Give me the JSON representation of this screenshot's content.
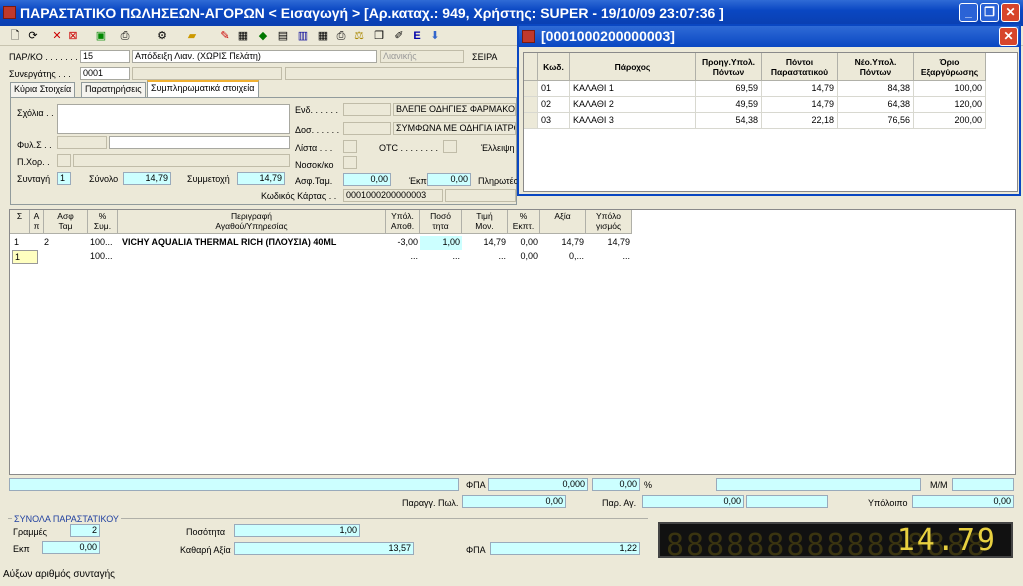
{
  "window": {
    "title": "ΠΑΡΑΣΤΑΤΙΚΟ ΠΩΛΗΣΕΩΝ-ΑΓΟΡΩΝ < Εισαγωγή > [Αρ.καταχ.: 949, Χρήστης: SUPER - 19/10/09 23:07:36 ]"
  },
  "header": {
    "parko_label": "ΠΑΡ/ΚΟ . . . . . . . .",
    "parko_code": "15",
    "parko_desc": "Απόδειξη Λιαν. (ΧΩΡΙΣ Πελάτη)",
    "retail": "Λιανικής",
    "seira_label": "ΣΕΙΡΑ",
    "synergatis_label": "Συνεργάτης . . .",
    "synergatis_code": "0001"
  },
  "tabs": [
    "Κύρια Στοιχεία",
    "Παρατηρήσεις",
    "Συμπληρωματικά στοιχεία"
  ],
  "panel": {
    "sxolia": "Σχόλια . .",
    "fyl": "Φυλ.Σ . .",
    "pxor": "Π.Χορ. .",
    "syntagi": "Συνταγή",
    "syntagi_val": "1",
    "synolo": "Σύνολο",
    "synolo_val": "14,79",
    "symmetoxi": "Συμμετοχή",
    "symmetoxi_val": "14,79",
    "end": "Ενδ. . . . . .",
    "end_val": "ΒΛΕΠΕ ΟΔΗΓΙΕΣ ΦΑΡΜΑΚΟΥ...",
    "dos": "Δοσ. . . . . .",
    "dos_val": "ΣΥΜΦΩΝΑ ΜΕ ΟΔΗΓΙΑ ΙΑΤΡΟΥ",
    "lista": "Λίστα . . .",
    "otc": "OTC . . . . . . . .",
    "elleipsi": "Έλλειψη",
    "nosok": "Νοσοκ/κο",
    "asftam": "Ασφ.Ταμ.",
    "asftam_val": "0,00",
    "ekpt": "Έκπτ.",
    "ekpt_val": "0,00",
    "plirotea": "Πληρωτέο",
    "kodikos": "Κωδικός Κάρτας . .",
    "kodikos_val": "0001000200000003"
  },
  "grid": {
    "headers": [
      "Σ",
      "Α\nπ",
      "Ασφ\nΤαμ",
      "%\nΣυμ.",
      "Περιγραφή\nΑγαθού/Υπηρεσίας",
      "Υπόλ.\nΑποθ.",
      "Ποσό\nτητα",
      "Τιμή\nΜον.",
      "%\nΕκπτ.",
      "Αξία",
      "Υπόλο\nγισμός"
    ],
    "rows": [
      [
        "1",
        "2",
        "",
        "100...",
        "VICHY AQUALIA THERMAL RICH (ΠΛΟΥΣΙΑ) 40ML",
        "-3,00",
        "1,00",
        "14,79",
        "0,00",
        "14,79",
        "14,79"
      ],
      [
        "1",
        "",
        "",
        "100...",
        "",
        "...",
        "...",
        "...",
        "0,00",
        "0,...",
        "..."
      ]
    ]
  },
  "popup": {
    "title": "[0001000200000003]",
    "headers": [
      "Κωδ.",
      "Πάροχος",
      "Προηγ.Υπολ.\nΠόντων",
      "Πόντοι\nΠαραστατικού",
      "Νέο.Υπολ.\nΠόντων",
      "Όριο\nΕξαργύρωσης"
    ],
    "rows": [
      [
        "01",
        "ΚΑΛΑΘΙ 1",
        "69,59",
        "14,79",
        "84,38",
        "100,00"
      ],
      [
        "02",
        "ΚΑΛΑΘΙ 2",
        "49,59",
        "14,79",
        "64,38",
        "120,00"
      ],
      [
        "03",
        "ΚΑΛΑΘΙ 3",
        "54,38",
        "22,18",
        "76,56",
        "200,00"
      ]
    ]
  },
  "footer": {
    "fpa": "ΦΠΑ",
    "fpa1": "0,000",
    "fpa2": "0,00",
    "pct": "%",
    "mm": "Μ/Μ",
    "paragg": "Παραγγ. Πωλ.",
    "paragg_val": "0,00",
    "par_ag": "Παρ. Αγ.",
    "par_ag_val": "0,00",
    "ypoloipo": "Υπόλοιπο",
    "ypoloipo_val": "0,00"
  },
  "totals": {
    "group": "ΣΥΝΟΛΑ ΠΑΡΑΣΤΑΤΙΚΟΥ",
    "grammes": "Γραμμές",
    "grammes_val": "2",
    "ekp": "Εκπ",
    "ekp_val": "0,00",
    "posotita": "Ποσότητα",
    "posotita_val": "1,00",
    "kathari": "Καθαρή Αξία",
    "kathari_val": "13,57",
    "fpa": "ΦΠΑ",
    "fpa_val": "1,22",
    "display": "14.79",
    "display_ghost": "8888888888888888"
  },
  "status": {
    "text": "Αύξων αριθμός συνταγής"
  }
}
